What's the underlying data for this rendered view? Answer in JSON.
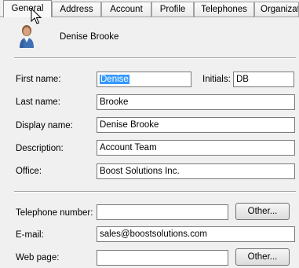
{
  "tabs": [
    {
      "label": "General",
      "active": true
    },
    {
      "label": "Address"
    },
    {
      "label": "Account"
    },
    {
      "label": "Profile"
    },
    {
      "label": "Telephones"
    },
    {
      "label": "Organizat"
    }
  ],
  "user": {
    "display": "Denise Brooke",
    "icon": "user-icon"
  },
  "form": {
    "first_name": {
      "label": "First name:",
      "value": "Denise"
    },
    "initials": {
      "label": "Initials:",
      "value": "DB"
    },
    "last_name": {
      "label": "Last name:",
      "value": "Brooke"
    },
    "display_name": {
      "label": "Display name:",
      "value": "Denise Brooke"
    },
    "description": {
      "label": "Description:",
      "value": "Account Team"
    },
    "office": {
      "label": "Office:",
      "value": "Boost Solutions Inc."
    },
    "telephone": {
      "label": "Telephone number:",
      "value": "",
      "other_label": "Other..."
    },
    "email": {
      "label": "E-mail:",
      "value": "sales@boostsolutions.com"
    },
    "web_page": {
      "label": "Web page:",
      "value": "",
      "other_label": "Other..."
    }
  },
  "colors": {
    "selection": "#3399ff",
    "panel": "#f0f0f0"
  }
}
